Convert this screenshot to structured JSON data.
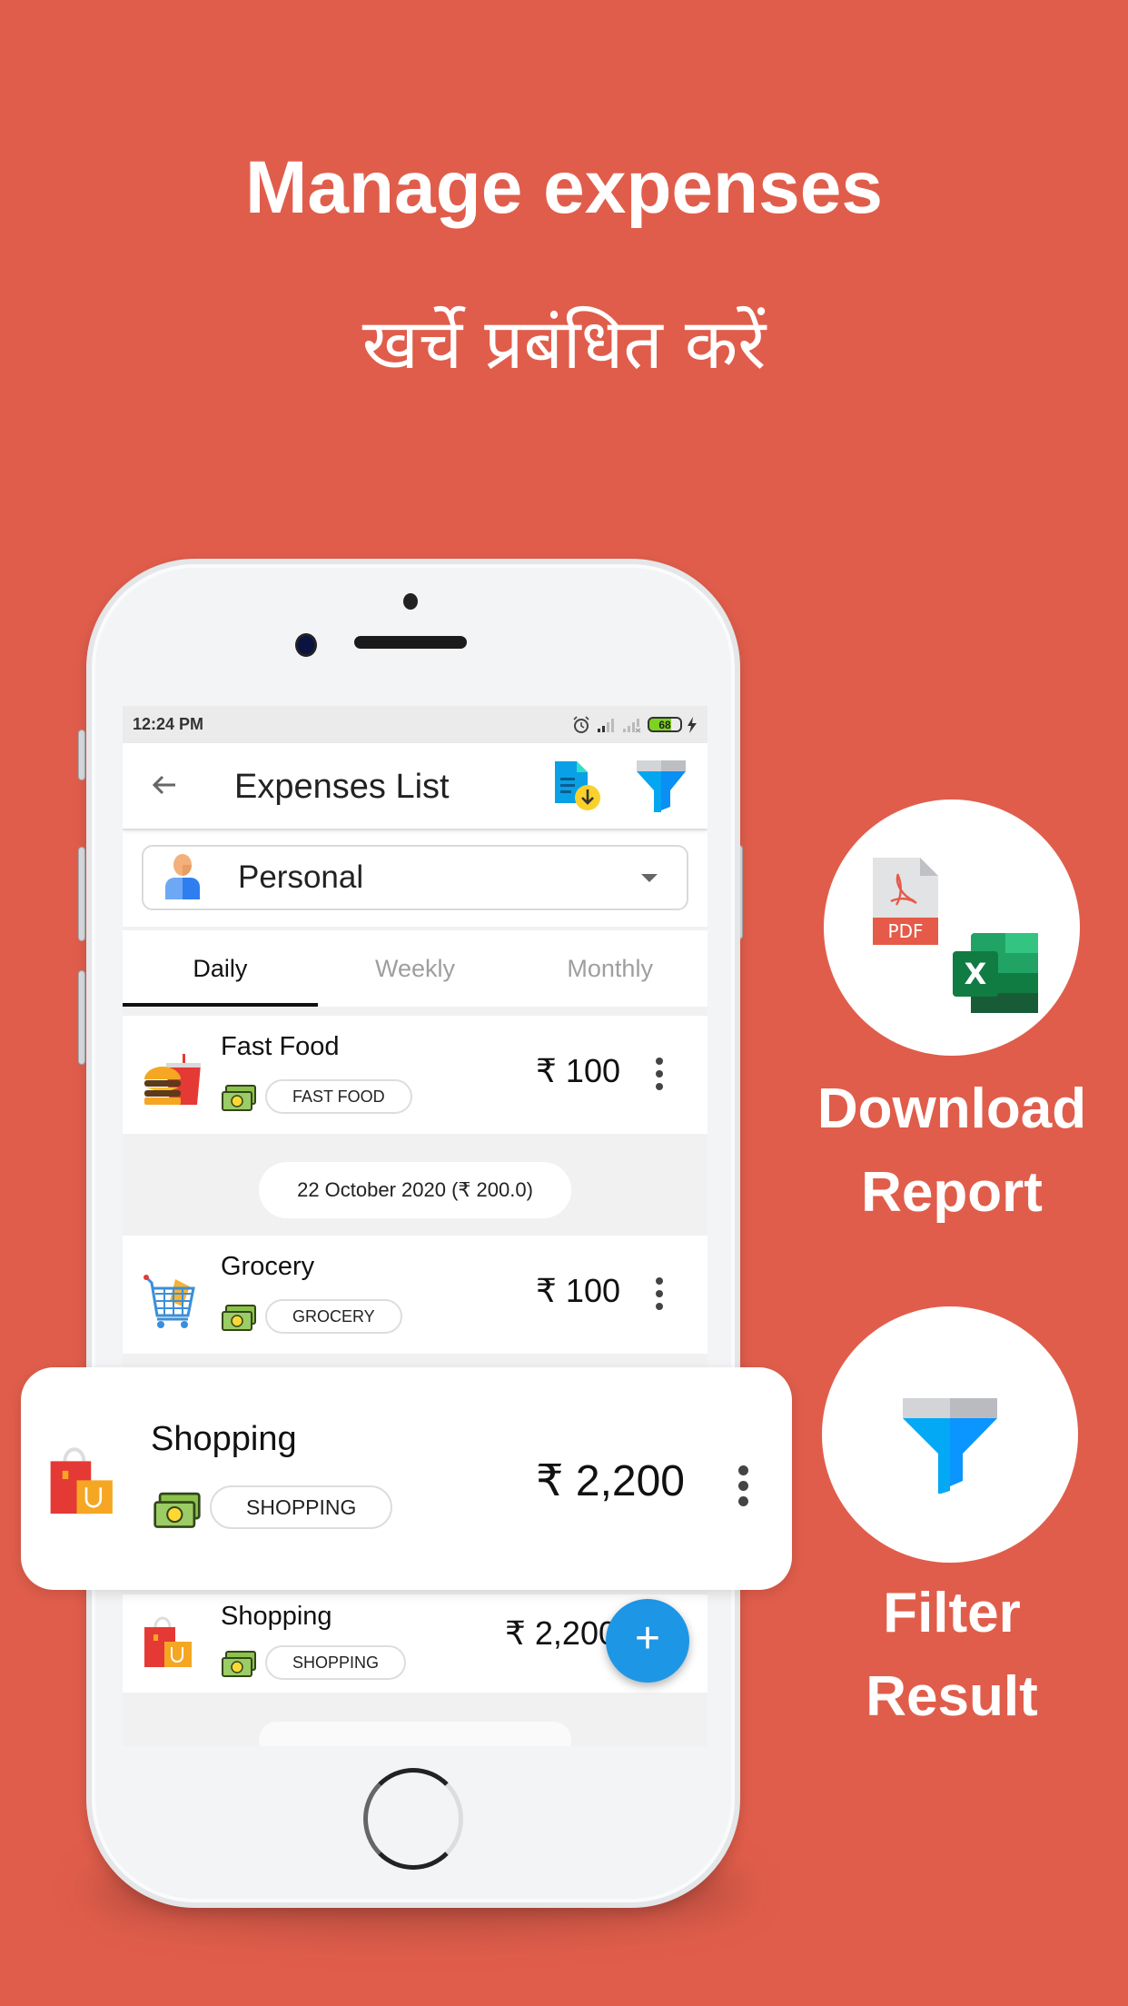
{
  "promo": {
    "headline_en": "Manage expenses",
    "headline_hi": "खर्चे प्रबंधित करें",
    "background_color": "#E05D4B"
  },
  "status_bar": {
    "time": "12:24 PM",
    "battery_level": "68",
    "icons": [
      "alarm-icon",
      "signal-icon",
      "signal-off-icon",
      "battery-icon",
      "charging-icon"
    ]
  },
  "app_bar": {
    "title": "Expenses List",
    "back_icon": "arrow-back-icon",
    "actions": [
      "download-report-icon",
      "filter-icon"
    ]
  },
  "account_selector": {
    "selected": "Personal",
    "icon": "person-icon"
  },
  "tabs": [
    {
      "label": "Daily",
      "active": true
    },
    {
      "label": "Weekly",
      "active": false
    },
    {
      "label": "Monthly",
      "active": false
    }
  ],
  "expenses": [
    {
      "name": "Fast Food",
      "category": "FAST FOOD",
      "amount": "₹ 100",
      "icon": "burger-icon"
    },
    {
      "name": "Grocery",
      "category": "GROCERY",
      "amount": "₹ 100",
      "icon": "cart-icon"
    },
    {
      "name": "Shopping",
      "category": "SHOPPING",
      "amount": "₹ 2,200",
      "icon": "shopping-bag-icon"
    }
  ],
  "date_group": {
    "label": "22 October 2020  (₹ 200.0)"
  },
  "highlight": {
    "name": "Shopping",
    "category": "SHOPPING",
    "amount": "₹ 2,200"
  },
  "fab": {
    "label": "+"
  },
  "features": [
    {
      "title_line1": "Download",
      "title_line2": "Report",
      "icon": "pdf-excel-icon"
    },
    {
      "title_line1": "Filter",
      "title_line2": "Result",
      "icon": "funnel-icon"
    }
  ],
  "pdf_label": "PDF",
  "excel_label": "X"
}
